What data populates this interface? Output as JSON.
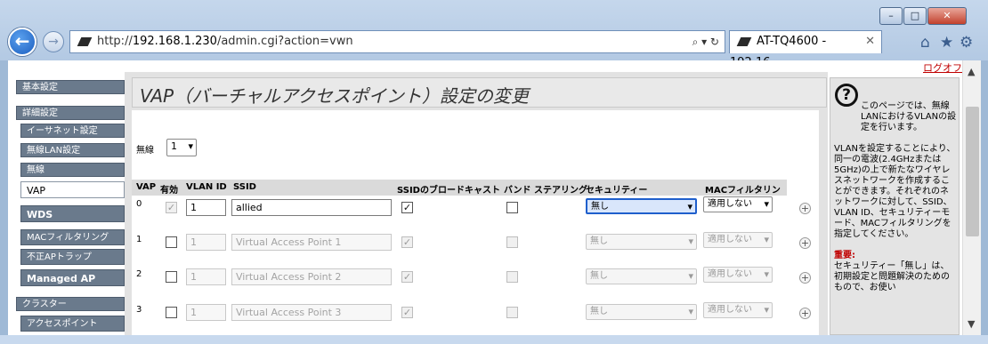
{
  "browser": {
    "url_prefix": "http://",
    "url_host": "192.168.1.230",
    "url_path": "/admin.cgi?action=vwn",
    "tab_title": "AT-TQ4600 - 192.16...",
    "window_buttons": [
      "–",
      "□",
      "✕"
    ],
    "address_icons": "⌕ ▾ ↻",
    "tab_close": "✕",
    "back": "←",
    "forward": "→",
    "home_icon": "⌂",
    "star_icon": "★",
    "gear_icon": "⚙"
  },
  "logout": "ログオフ",
  "nav": {
    "items": [
      {
        "label": "基本設定"
      },
      {
        "label": "詳細設定"
      },
      {
        "label": "イーサネット設定"
      },
      {
        "label": "無線LAN設定"
      },
      {
        "label": "無線"
      },
      {
        "label": "VAP"
      },
      {
        "label": "WDS"
      },
      {
        "label": "MACフィルタリング"
      },
      {
        "label": "不正APトラップ"
      },
      {
        "label": "Managed AP"
      },
      {
        "label": "クラスター"
      },
      {
        "label": "アクセスポイント"
      }
    ]
  },
  "page": {
    "title": "VAP（バーチャルアクセスポイント）設定の変更",
    "radio_label": "無線",
    "radio_value": "1"
  },
  "table": {
    "headers": [
      "VAP",
      "有効",
      "VLAN ID",
      "SSID",
      "SSIDのブロードキャスト",
      "バンド ステアリング",
      "セキュリティー",
      "MACフィルタリング"
    ],
    "rows": [
      {
        "vap": "0",
        "vlan": "1",
        "ssid": "allied",
        "security": "無し",
        "mac": "適用しない"
      },
      {
        "vap": "1",
        "vlan": "1",
        "ssid": "Virtual Access Point 1",
        "security": "無し",
        "mac": "適用しない"
      },
      {
        "vap": "2",
        "vlan": "1",
        "ssid": "Virtual Access Point 2",
        "security": "無し",
        "mac": "適用しない"
      },
      {
        "vap": "3",
        "vlan": "1",
        "ssid": "Virtual Access Point 3",
        "security": "無し",
        "mac": "適用しない"
      }
    ],
    "plus": "+",
    "check": "✓",
    "dropdown_arrow": "▾"
  },
  "help": {
    "icon": "?",
    "p1": "このページでは、無線LANにおけるVLANの設定を行います。",
    "p2": "VLANを設定することにより、同一の電波(2.4GHzまたは5GHz)の上で新たなワイヤレスネットワークを作成することができます。それぞれのネットワークに対して、SSID、VLAN ID、セキュリティーモード、MACフィルタリングを指定してください。",
    "important_label": "重要:",
    "p3": "セキュリティー「無し」は、初期設定と問題解決のためのもので、お使い"
  },
  "scrollbar": {
    "up": "▲",
    "down": "▼"
  }
}
